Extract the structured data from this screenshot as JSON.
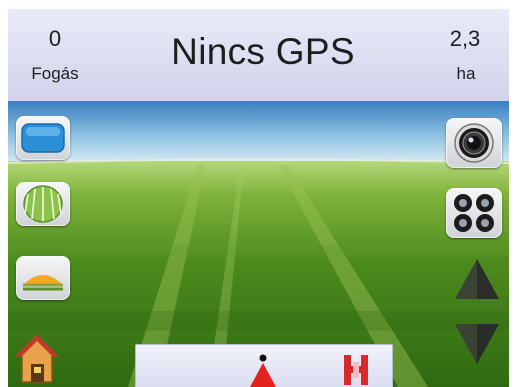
{
  "header": {
    "passes_value": "0",
    "passes_label": "Fogás",
    "gps_status": "Nincs GPS",
    "area_value": "2,3",
    "area_unit": "ha"
  },
  "side_controls_left": [
    {
      "name": "view-mode-button",
      "icon": "blue-screen-icon"
    },
    {
      "name": "guidance-mode-button",
      "icon": "straight-rows-icon"
    },
    {
      "name": "tilt-button",
      "icon": "curve-horizon-icon"
    }
  ],
  "side_controls_right": [
    {
      "name": "camera-button",
      "icon": "camera-lens-icon"
    },
    {
      "name": "boom-sections-button",
      "icon": "four-nozzles-icon"
    },
    {
      "name": "zoom-in-button",
      "icon": "arrow-up-icon"
    },
    {
      "name": "zoom-out-button",
      "icon": "arrow-down-icon"
    }
  ],
  "bottom": {
    "home_icon": "home-icon",
    "vehicle_icon": "vehicle-marker-icon",
    "boom_icon": "boom-status-icon"
  },
  "colors": {
    "header_bg": "#d8dbef",
    "accent_blue": "#2d8fd8",
    "vehicle_red": "#e3221f",
    "boom_red": "#d9282b"
  }
}
